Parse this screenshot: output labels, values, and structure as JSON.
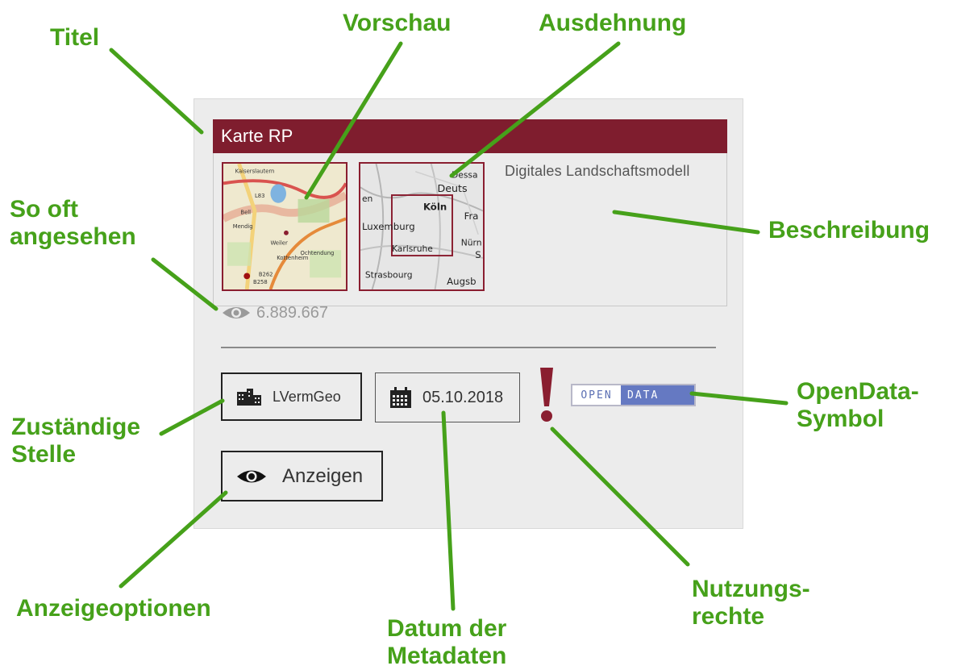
{
  "card": {
    "title": "Karte RP",
    "description": "Digitales Landschaftsmodell",
    "view_count": "6.889.667",
    "authority": "LVermGeo",
    "date": "05.10.2018",
    "show_button": "Anzeigen",
    "opendata_open": "OPEN",
    "opendata_data": "DATA"
  },
  "preview_map": {
    "labels": [
      "Kaiserslautern",
      "Bell",
      "Mendig",
      "Weiler",
      "Ochtendung",
      "Kottenheim",
      "B262",
      "B258",
      "L83"
    ]
  },
  "extent_map": {
    "labels": [
      "Dessa",
      "Deuts",
      "Köln",
      "Fra",
      "Luxemburg",
      "Nürn",
      "S",
      "Karlsruhe",
      "Strasbourg",
      "Augsb",
      "en"
    ]
  },
  "annotations": {
    "titel": "Titel",
    "vorschau": "Vorschau",
    "ausdehnung": "Ausdehnung",
    "so_oft_line1": "So oft",
    "so_oft_line2": "angesehen",
    "beschreibung": "Beschreibung",
    "opendata_line1": "OpenData-",
    "opendata_line2": "Symbol",
    "zustaendig_line1": "Zuständige",
    "zustaendig_line2": "Stelle",
    "anzeigeoptionen": "Anzeigeoptionen",
    "datum_line1": "Datum der",
    "datum_line2": "Metadaten",
    "nutzung_line1": "Nutzungs-",
    "nutzung_line2": "rechte"
  },
  "colors": {
    "title_bar": "#7f1d2e",
    "annotation": "#46a11a",
    "opendata_blue": "#6579c2",
    "exclamation": "#8a1e30"
  }
}
